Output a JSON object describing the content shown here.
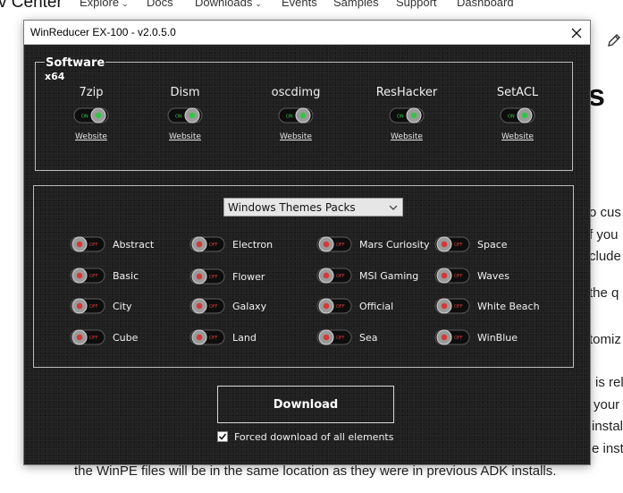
{
  "background_page": {
    "brand": "v Center",
    "nav": [
      {
        "label": "Explore",
        "has_chevron": true
      },
      {
        "label": "Docs",
        "has_chevron": false
      },
      {
        "label": "Downloads",
        "has_chevron": true
      },
      {
        "label": "Events",
        "has_chevron": false
      },
      {
        "label": "Samples",
        "has_chevron": false
      },
      {
        "label": "Support",
        "has_chevron": false
      },
      {
        "label": "Dashboard",
        "has_chevron": false
      }
    ],
    "heading_fragment": "s",
    "text_fragments": [
      "o cus",
      "f you",
      "clude",
      "the q",
      "tomiz",
      "is rel",
      "your",
      "instal",
      "e insta"
    ],
    "bottom_line": "the WinPE files will be in the same location as they were in previous ADK installs.",
    "edit_icon": "pencil-icon"
  },
  "dialog": {
    "title": "WinReducer EX-100 - v2.0.5.0",
    "close_icon": "close-icon",
    "software": {
      "title": "Software",
      "subtitle": "x64",
      "items": [
        {
          "name": "7zip",
          "toggle_on": true,
          "link": "Website"
        },
        {
          "name": "Dism",
          "toggle_on": true,
          "link": "Website"
        },
        {
          "name": "oscdimg",
          "toggle_on": true,
          "link": "Website"
        },
        {
          "name": "ResHacker",
          "toggle_on": true,
          "link": "Website"
        },
        {
          "name": "SetACL",
          "toggle_on": true,
          "link": "Website"
        }
      ]
    },
    "themes": {
      "selected": "Windows Themes Packs",
      "items": [
        {
          "label": "Abstract",
          "on": false
        },
        {
          "label": "Basic",
          "on": false
        },
        {
          "label": "City",
          "on": false
        },
        {
          "label": "Cube",
          "on": false
        },
        {
          "label": "Electron",
          "on": false
        },
        {
          "label": "Flower",
          "on": false
        },
        {
          "label": "Galaxy",
          "on": false
        },
        {
          "label": "Land",
          "on": false
        },
        {
          "label": "Mars Curiosity",
          "on": false
        },
        {
          "label": "MSI Gaming",
          "on": false
        },
        {
          "label": "Official",
          "on": false
        },
        {
          "label": "Sea",
          "on": false
        },
        {
          "label": "Space",
          "on": false
        },
        {
          "label": "Waves",
          "on": false
        },
        {
          "label": "White Beach",
          "on": false
        },
        {
          "label": "WinBlue",
          "on": false
        }
      ]
    },
    "download_label": "Download",
    "forced": {
      "label": "Forced download of all elements",
      "checked": true
    },
    "colors": {
      "toggle_on": "#39c24a",
      "toggle_off": "#d23a3a",
      "panel": "#1f1f1f"
    }
  }
}
